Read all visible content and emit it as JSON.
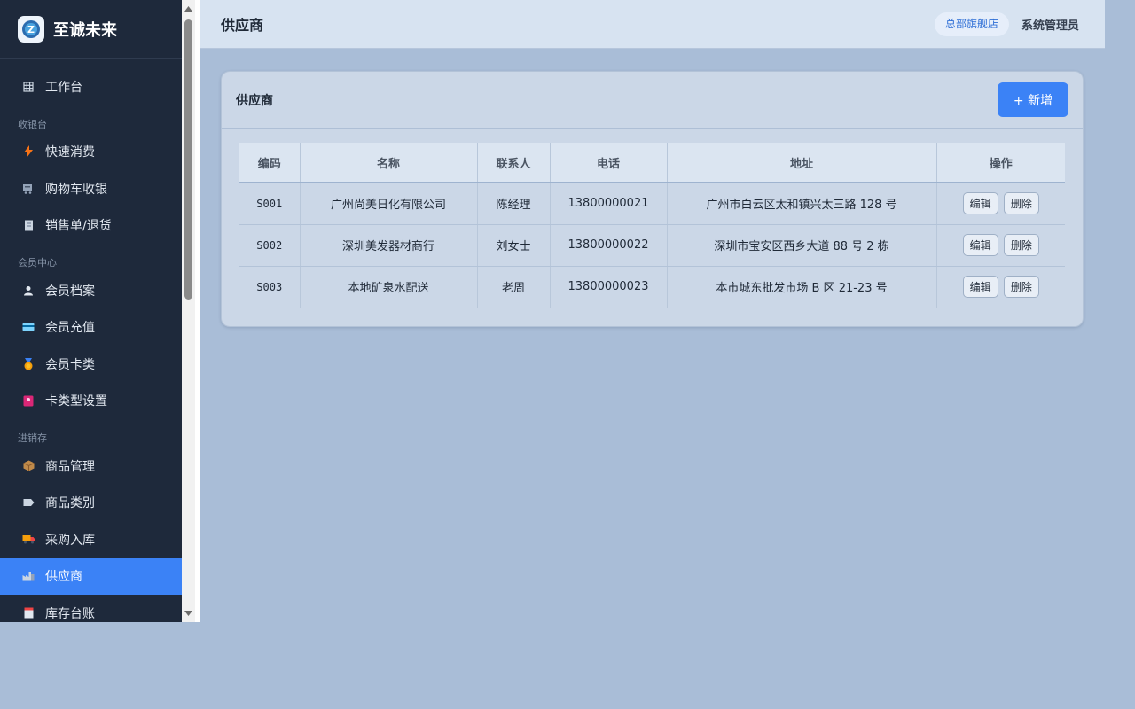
{
  "brand": {
    "name": "至诚未来",
    "logo_letter": "Z"
  },
  "sidebar": {
    "workbench": {
      "label": "工作台",
      "icon": "grid-icon"
    },
    "sections": [
      {
        "title": "收银台",
        "items": [
          {
            "label": "快速消费",
            "icon": "bolt-icon"
          },
          {
            "label": "购物车收银",
            "icon": "cart-icon"
          },
          {
            "label": "销售单/退货",
            "icon": "receipt-icon"
          }
        ]
      },
      {
        "title": "会员中心",
        "items": [
          {
            "label": "会员档案",
            "icon": "user-icon"
          },
          {
            "label": "会员充值",
            "icon": "card-icon"
          },
          {
            "label": "会员卡类",
            "icon": "medal-icon"
          },
          {
            "label": "卡类型设置",
            "icon": "card-settings-icon"
          }
        ]
      },
      {
        "title": "进销存",
        "items": [
          {
            "label": "商品管理",
            "icon": "box-icon"
          },
          {
            "label": "商品类别",
            "icon": "tag-icon"
          },
          {
            "label": "采购入库",
            "icon": "truck-icon"
          },
          {
            "label": "供应商",
            "icon": "factory-icon"
          },
          {
            "label": "库存台账",
            "icon": "ledger-icon"
          }
        ]
      }
    ],
    "active_label": "供应商"
  },
  "header": {
    "title": "供应商",
    "store": "总部旗舰店",
    "user": "系统管理员"
  },
  "card": {
    "title": "供应商",
    "add_label": "+ 新增"
  },
  "table": {
    "columns": [
      "编码",
      "名称",
      "联系人",
      "电话",
      "地址",
      "操作"
    ],
    "rows": [
      {
        "code": "S001",
        "name": "广州尚美日化有限公司",
        "contact": "陈经理",
        "phone": "13800000021",
        "address": "广州市白云区太和镇兴太三路 128 号"
      },
      {
        "code": "S002",
        "name": "深圳美发器材商行",
        "contact": "刘女士",
        "phone": "13800000022",
        "address": "深圳市宝安区西乡大道 88 号 2 栋"
      },
      {
        "code": "S003",
        "name": "本地矿泉水配送",
        "contact": "老周",
        "phone": "13800000023",
        "address": "本市城东批发市场 B 区 21-23 号"
      }
    ],
    "edit_label": "编辑",
    "delete_label": "删除"
  },
  "colors": {
    "accent": "#3b82f6",
    "sidebar_bg": "#1e293b",
    "page_bg": "#a9bdd7"
  }
}
